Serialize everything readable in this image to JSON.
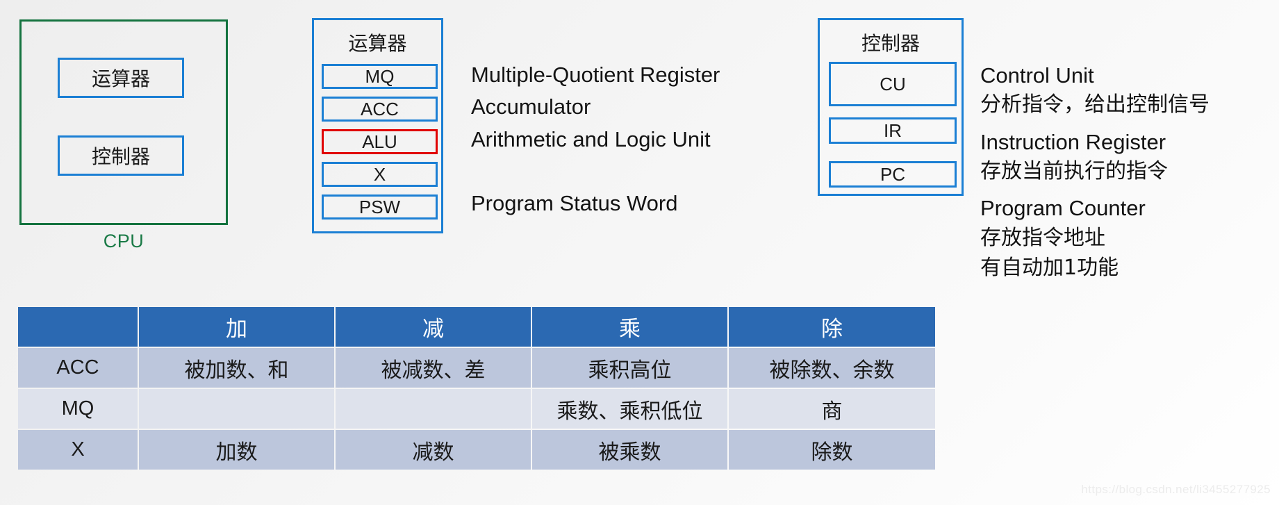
{
  "cpu": {
    "label": "CPU",
    "inner": [
      {
        "name": "alu-box",
        "label": "运算器"
      },
      {
        "name": "cu-box",
        "label": "控制器"
      }
    ]
  },
  "alu_group": {
    "title": "运算器",
    "registers": [
      {
        "label": "MQ",
        "highlight": "blue"
      },
      {
        "label": "ACC",
        "highlight": "blue"
      },
      {
        "label": "ALU",
        "highlight": "red"
      },
      {
        "label": "X",
        "highlight": "blue"
      },
      {
        "label": "PSW",
        "highlight": "blue"
      }
    ],
    "descriptions": [
      "Multiple-Quotient Register",
      "Accumulator",
      "Arithmetic and Logic Unit",
      "Program Status Word"
    ]
  },
  "cu_group": {
    "title": "控制器",
    "registers": [
      {
        "label": "CU"
      },
      {
        "label": "IR"
      },
      {
        "label": "PC"
      }
    ],
    "descriptions": [
      {
        "en": "Control Unit",
        "cn": [
          "分析指令，给出控制信号"
        ]
      },
      {
        "en": "Instruction Register",
        "cn": [
          "存放当前执行的指令"
        ]
      },
      {
        "en": "Program Counter",
        "cn": [
          "存放指令地址",
          "有自动加1功能"
        ]
      }
    ]
  },
  "table": {
    "columns": [
      "",
      "加",
      "减",
      "乘",
      "除"
    ],
    "rows": [
      {
        "label": "ACC",
        "cells": [
          "被加数、和",
          "被减数、差",
          "乘积高位",
          "被除数、余数"
        ]
      },
      {
        "label": "MQ",
        "cells": [
          "",
          "",
          "乘数、乘积低位",
          "商"
        ]
      },
      {
        "label": "X",
        "cells": [
          "加数",
          "减数",
          "被乘数",
          "除数"
        ]
      }
    ]
  },
  "watermark": "https://blog.csdn.net/li3455277925",
  "colors": {
    "header_blue": "#2b69b2",
    "box_blue": "#1b7fd4",
    "alu_red": "#e00000",
    "cpu_green": "#14733f",
    "row_dark": "#bcc6dc",
    "row_light": "#dee2ec"
  }
}
